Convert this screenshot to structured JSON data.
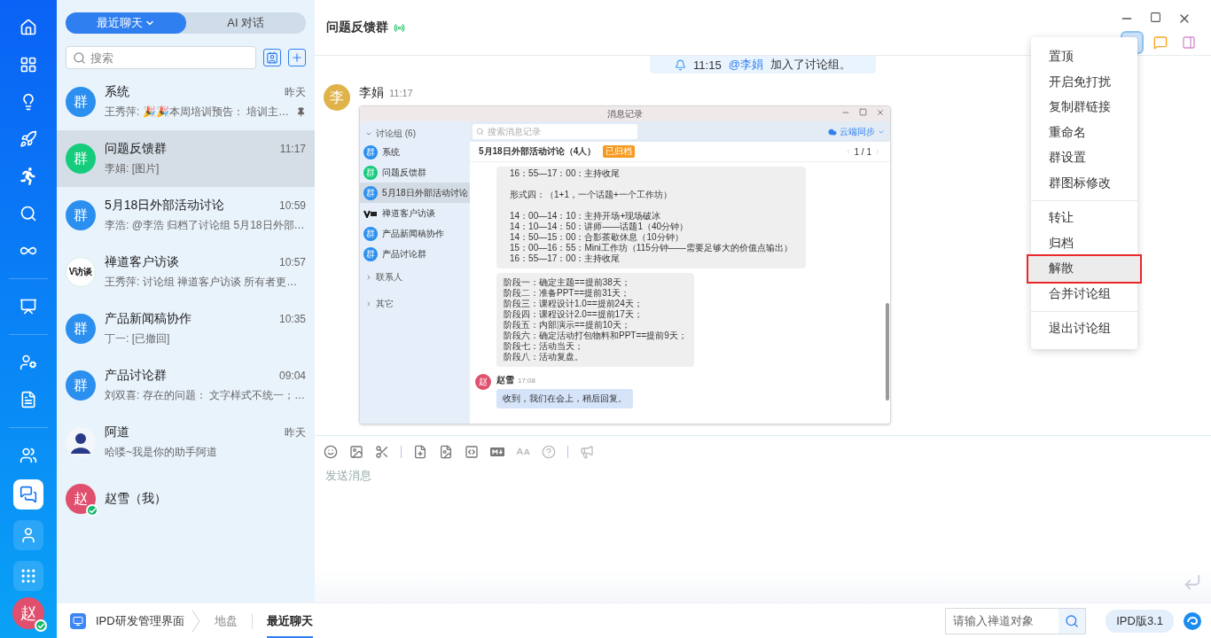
{
  "rail": {
    "items": [
      {
        "selected": false
      },
      {
        "selected": false
      },
      {
        "selected": false
      },
      {
        "selected": false
      },
      {
        "selected": false
      },
      {
        "selected": false
      },
      {
        "selected": false
      },
      {
        "selected": false
      },
      {
        "selected": false
      },
      {
        "selected": false
      },
      {
        "selected": false
      },
      {
        "selected": true
      },
      {
        "selected": false
      },
      {
        "selected": false
      }
    ],
    "avatar": {
      "text": "赵",
      "online": true
    }
  },
  "chat_panel": {
    "tabs": [
      {
        "label": "最近聊天",
        "selected": true
      },
      {
        "label": "AI 对话",
        "selected": false
      }
    ],
    "search": {
      "placeholder": "搜索"
    },
    "chats": [
      {
        "kind": "text",
        "avatar": "群",
        "color": "#2b8ff0",
        "name": "系统",
        "time": "昨天",
        "preview": "王秀萍: 🎉🎉本周培训预告： 培训主…",
        "pinned": true,
        "online": false,
        "selected": false
      },
      {
        "kind": "text",
        "avatar": "群",
        "color": "#14cc7c",
        "name": "问题反馈群",
        "time": "11:17",
        "preview": "李娟: [图片]",
        "pinned": false,
        "online": false,
        "selected": true
      },
      {
        "kind": "text",
        "avatar": "群",
        "color": "#2b8ff0",
        "name": "5月18日外部活动讨论",
        "time": "10:59",
        "preview": "李浩: @李浩 归档了讨论组 5月18日外部…",
        "pinned": false,
        "online": false,
        "selected": false
      },
      {
        "kind": "logo",
        "avatar": "V访谈",
        "name": "禅道客户访谈",
        "time": "10:57",
        "preview": "王秀萍: 讨论组 禅道客户访谈 所有者更…",
        "pinned": false,
        "online": false,
        "selected": false
      },
      {
        "kind": "text",
        "avatar": "群",
        "color": "#2b8ff0",
        "name": "产品新闻稿协作",
        "time": "10:35",
        "preview": "丁一: [已撤回]",
        "pinned": false,
        "online": false,
        "selected": false
      },
      {
        "kind": "text",
        "avatar": "群",
        "color": "#2b8ff0",
        "name": "产品讨论群",
        "time": "09:04",
        "preview": "刘双喜: 存在的问题： 文字样式不统一；…",
        "pinned": false,
        "online": false,
        "selected": false
      },
      {
        "kind": "figure",
        "name": "阿道",
        "time": "昨天",
        "preview": "哈喽~我是你的助手阿道",
        "pinned": false,
        "online": false,
        "selected": false
      },
      {
        "kind": "text",
        "avatar": "赵",
        "color": "#e0506e",
        "name": "赵雪（我）",
        "pinned": false,
        "online": true,
        "selected": false
      }
    ]
  },
  "conversation": {
    "title": "问题反馈群",
    "live": true,
    "notice": {
      "time": "11:15",
      "mention": "@李娟",
      "text": "加入了讨论组。"
    },
    "message": {
      "sender": "李娟",
      "avatar": "李",
      "time": "11:17",
      "shared_image": {
        "title": "消息记录",
        "sidebar": {
          "group": {
            "label": "讨论组 (6)",
            "expanded": true,
            "children": [
              {
                "kind": "text",
                "avatar": "群",
                "color": "#2b8ff0",
                "name": "系统",
                "selected": false
              },
              {
                "kind": "text",
                "avatar": "群",
                "color": "#14cc7c",
                "name": "问题反馈群",
                "selected": false
              },
              {
                "kind": "text",
                "avatar": "群",
                "color": "#2b8ff0",
                "name": "5月18日外部活动讨论",
                "selected": true
              },
              {
                "kind": "logo",
                "name": "禅道客户访谈",
                "selected": false
              },
              {
                "kind": "text",
                "avatar": "群",
                "color": "#2b8ff0",
                "name": "产品新闻稿协作",
                "selected": false
              },
              {
                "kind": "text",
                "avatar": "群",
                "color": "#2b8ff0",
                "name": "产品讨论群",
                "selected": false
              }
            ]
          },
          "sections": [
            {
              "label": "联系人",
              "expanded": false
            },
            {
              "label": "其它",
              "expanded": false
            }
          ]
        },
        "search": {
          "placeholder": "搜索消息记录"
        },
        "sync": "云端同步",
        "header": {
          "title": "5月18日外部活动讨论（4人）",
          "badge": "已归档",
          "pager": "1 / 1"
        },
        "bubbles": [
          {
            "paragraphs": [
              [
                "16：55—17：00：主持收尾"
              ],
              [
                "形式四：（1+1，一个话题+一个工作坊）"
              ],
              [
                "14：00—14：10：主持开场+现场破冰",
                "14：10—14：50：讲师——话题1（40分钟）",
                "14：50—15：00：合影茶歇休息（10分钟）",
                "15：00—16：55：Mini工作坊（115分钟——需要足够大的价值点输出）",
                "16：55—17：00：主持收尾"
              ]
            ]
          },
          {
            "paragraphs": [
              [
                "阶段一：确定主题==提前38天；",
                "阶段二：准备PPT==提前31天；",
                "阶段三：课程设计1.0==提前24天；",
                "阶段四：课程设计2.0==提前17天；",
                "阶段五：内部演示==提前10天；",
                "阶段六：确定活动打包物料和PPT==提前9天；",
                "阶段七：活动当天；",
                "阶段八：活动复盘。"
              ]
            ]
          }
        ],
        "reply": {
          "sender": "赵雪",
          "avatar": "赵",
          "time": "17:08",
          "text": "收到，我们在会上，稍后回复。"
        }
      }
    },
    "composer": {
      "placeholder": "发送消息"
    },
    "menu": {
      "open": true,
      "groups": [
        [
          {
            "label": "置顶",
            "selected": false
          },
          {
            "label": "开启免打扰",
            "selected": false
          },
          {
            "label": "复制群链接",
            "selected": false
          },
          {
            "label": "重命名",
            "selected": false
          },
          {
            "label": "群设置",
            "selected": false
          },
          {
            "label": "群图标修改",
            "selected": false
          }
        ],
        [
          {
            "label": "转让",
            "selected": false
          },
          {
            "label": "归档",
            "selected": false
          },
          {
            "label": "解散",
            "selected": true
          },
          {
            "label": "合并讨论组",
            "selected": false
          }
        ],
        [
          {
            "label": "退出讨论组",
            "selected": false
          }
        ]
      ]
    }
  },
  "bottom_bar": {
    "app": "IPD研发管理界面",
    "crumbs": [
      {
        "label": "地盘",
        "selected": false
      },
      {
        "label": "最近聊天",
        "selected": true
      }
    ],
    "search": {
      "placeholder": "请输入禅道对象"
    },
    "version": "IPD版3.1"
  }
}
